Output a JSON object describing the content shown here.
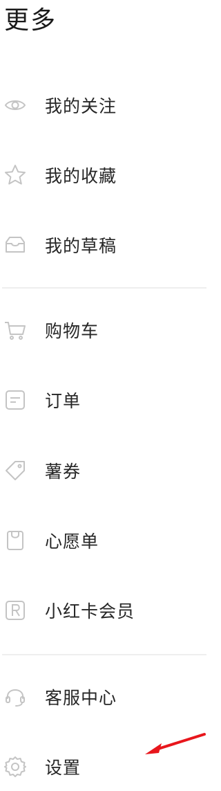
{
  "header": {
    "title": "更多"
  },
  "menu": {
    "group1": [
      {
        "label": "我的关注",
        "icon": "eye-icon"
      },
      {
        "label": "我的收藏",
        "icon": "star-icon"
      },
      {
        "label": "我的草稿",
        "icon": "inbox-tray-icon"
      }
    ],
    "group2": [
      {
        "label": "购物车",
        "icon": "shopping-cart-icon"
      },
      {
        "label": "订单",
        "icon": "order-card-icon"
      },
      {
        "label": "薯券",
        "icon": "coupon-tag-icon"
      },
      {
        "label": "心愿单",
        "icon": "wishlist-bag-icon"
      },
      {
        "label": "小红卡会员",
        "icon": "r-badge-icon"
      }
    ],
    "group3": [
      {
        "label": "客服中心",
        "icon": "headset-icon"
      },
      {
        "label": "设置",
        "icon": "gear-icon"
      }
    ]
  },
  "colors": {
    "icon_stroke": "#c4c4c4",
    "divider": "#eeeeee",
    "annotation_arrow": "#e8161c"
  }
}
